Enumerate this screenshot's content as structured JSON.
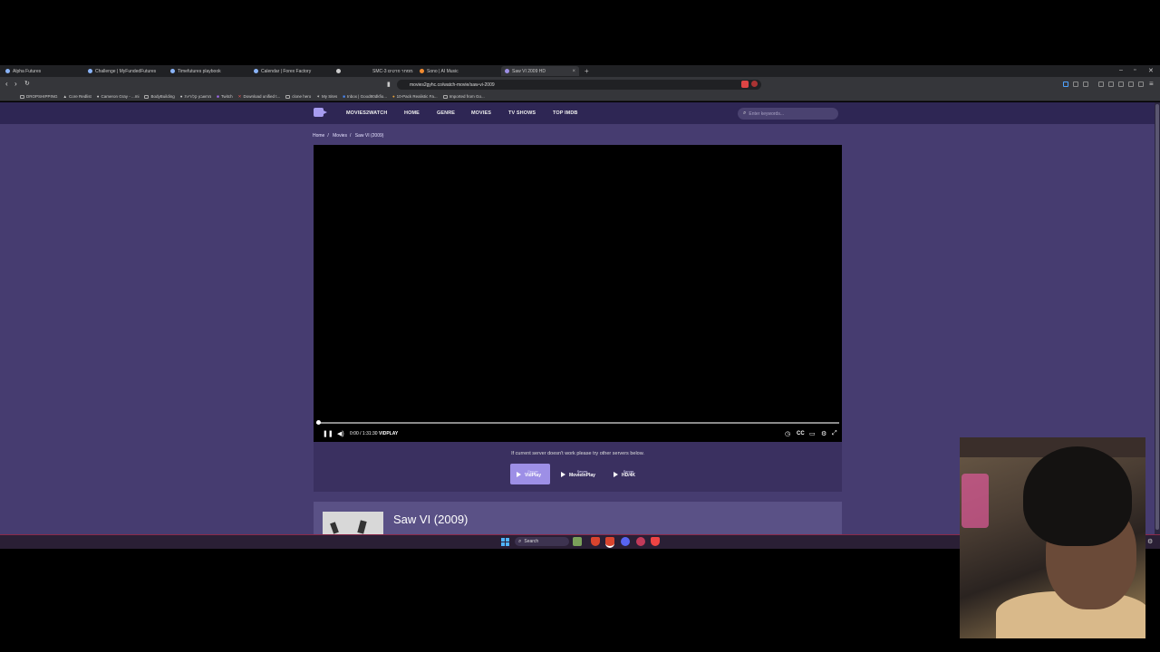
{
  "browser": {
    "tabs": [
      {
        "label": "Alpha Futures",
        "active": false
      },
      {
        "label": "Challenge | MyFundedFutures",
        "active": false
      },
      {
        "label": "Timefutures playbook",
        "active": false
      },
      {
        "label": "Calendar | Forex Factory",
        "active": false
      },
      {
        "label": "",
        "active": false
      },
      {
        "label": "SMC-3 מסחר פרטים",
        "active": false
      },
      {
        "label": "Sono | AI Music",
        "active": false
      },
      {
        "label": "Saw VI 2009 HD",
        "active": true
      }
    ],
    "url": "movies2gyhc.co/watch-movie/saw-vi-2009",
    "bookmarks": [
      "DROPSHIPPING",
      "Core Redlist",
      "Cameron Gray - ...mi",
      "BodyBuilding",
      "מחשבון קלוריות",
      "Twitch",
      "Download unified t...",
      "clone hero",
      "My Sites",
      "Inbox | Good80dkfio...",
      "10-Pack Realistic Fa...",
      "Imported from Go..."
    ]
  },
  "site": {
    "brand": "MOVIES2WATCH",
    "nav": [
      "HOME",
      "GENRE",
      "MOVIES",
      "TV SHOWS",
      "TOP IMDB"
    ],
    "search_placeholder": "Enter keywords...",
    "breadcrumb": [
      "Home",
      "Movies",
      "Saw VI (2009)"
    ],
    "player": {
      "time_current": "0:00",
      "time_total": "1:31:30",
      "brand": "VIDPLAY",
      "progress": 0.0,
      "cc_label": "CC"
    },
    "server_message": "If current server doesn't work please try other servers below.",
    "servers": [
      {
        "top": "Server",
        "name": "VidPlay",
        "active": true
      },
      {
        "top": "Server",
        "name": "MovieInPlay",
        "active": false
      },
      {
        "top": "Server",
        "name": "HD/4K",
        "active": false
      }
    ],
    "movie_title": "Saw VI (2009)"
  },
  "taskbar": {
    "search_label": "Search"
  },
  "colors": {
    "site_bg": "#463c70",
    "nav_bg": "#2e2654",
    "accent": "#9d8fe6"
  }
}
